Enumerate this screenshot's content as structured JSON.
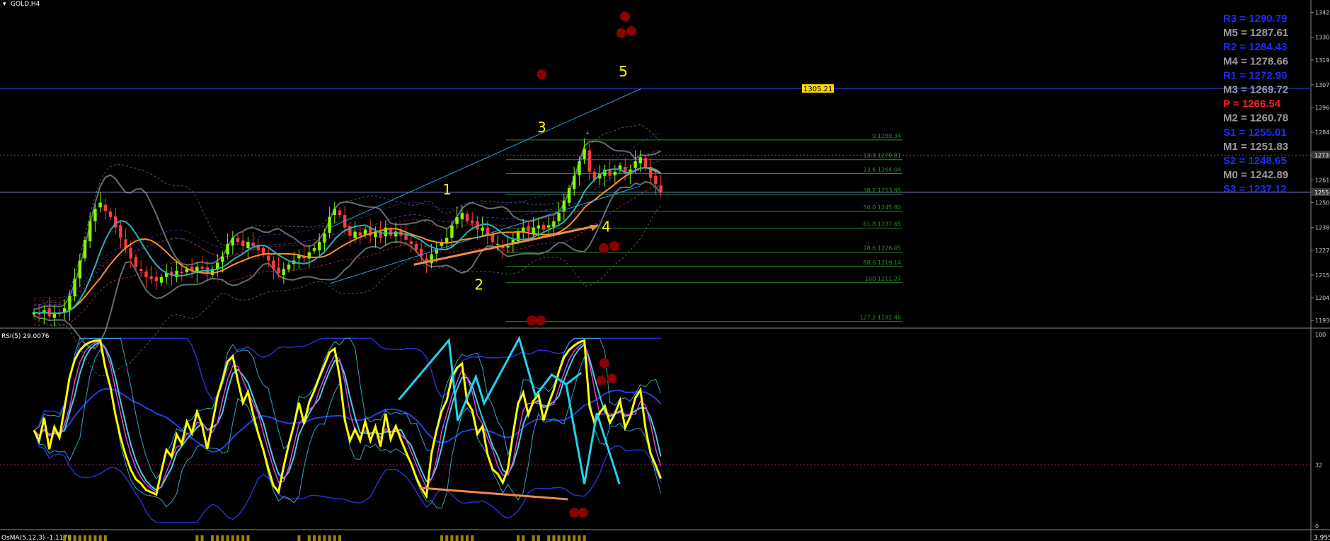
{
  "window": {
    "symbol_label": "GOLD,H4",
    "rsi_label": "RSI(5) 29.0076",
    "osma_label": "OsMA(5,12,3) -1.1178",
    "osma_axis_label": "3.955"
  },
  "colors": {
    "background": "#000000",
    "bull_candle": "#7CFC00",
    "bear_candle": "#ff3b3b",
    "horizontal_line": "#2f3fd8",
    "hline_label_bg": "#ffd700",
    "wave_label": "#ffff00",
    "fib": "#2e8b2e",
    "rsi_main": "#ffff00",
    "arrow_cyan": "#22d3ee",
    "arrow_orange": "#f08a4b",
    "dot": "#8b0000"
  },
  "price_axis": {
    "ticks": [
      "1342",
      "1330",
      "1319",
      "1307",
      "1296",
      "1284",
      "1273",
      "1261",
      "1250",
      "1238",
      "1227",
      "1215",
      "1204",
      "1193"
    ],
    "marker_1": "1273",
    "marker_2": "1255"
  },
  "rsi_axis": {
    "ticks": [
      "100",
      "32",
      "0"
    ]
  },
  "horizontal_line_label": "1305.21",
  "pivots": [
    {
      "label": "R3 = 1290.79",
      "color": "#1f2bff"
    },
    {
      "label": "M5 = 1287.61",
      "color": "#9a9a9a"
    },
    {
      "label": "R2 = 1284.43",
      "color": "#1f2bff"
    },
    {
      "label": "M4 = 1278.66",
      "color": "#9a9a9a"
    },
    {
      "label": "R1 = 1272.90",
      "color": "#1f2bff"
    },
    {
      "label": "M3 = 1269.72",
      "color": "#9a9a9a"
    },
    {
      "label": "P   = 1266.54",
      "color": "#ff2020"
    },
    {
      "label": "M2 = 1260.78",
      "color": "#9a9a9a"
    },
    {
      "label": "S1 = 1255.01",
      "color": "#1f2bff"
    },
    {
      "label": "M1 = 1251.83",
      "color": "#9a9a9a"
    },
    {
      "label": "S2 = 1248.65",
      "color": "#1f2bff"
    },
    {
      "label": "M0 = 1242.89",
      "color": "#9a9a9a"
    },
    {
      "label": "S3 = 1237.12",
      "color": "#1f2bff"
    }
  ],
  "fib_levels": [
    "0 1280.34",
    "13.8 1270.81",
    "23.6 1264.04",
    "38.2 1253.95",
    "50.0 1245.80",
    "61.8 1237.65",
    "78.6 1226.05",
    "88.6 1219.14",
    "100 1211.27",
    "127.2 1192.48"
  ],
  "wave_labels": [
    "1",
    "2",
    "3",
    "4",
    "5"
  ],
  "chart_data": {
    "type": "candlestick",
    "symbol": "GOLD",
    "timeframe": "H4",
    "y_range": [
      1190,
      1348
    ],
    "closes": [
      1197,
      1196,
      1198,
      1195,
      1197,
      1196,
      1199,
      1205,
      1213,
      1222,
      1232,
      1241,
      1247,
      1250,
      1246,
      1243,
      1238,
      1233,
      1228,
      1223,
      1219,
      1217,
      1214,
      1213,
      1212,
      1214,
      1216,
      1215,
      1217,
      1216,
      1218,
      1217,
      1219,
      1218,
      1216,
      1218,
      1221,
      1224,
      1230,
      1233,
      1231,
      1229,
      1231,
      1229,
      1227,
      1225,
      1222,
      1218,
      1216,
      1218,
      1220,
      1222,
      1225,
      1223,
      1226,
      1228,
      1231,
      1235,
      1243,
      1247,
      1244,
      1238,
      1234,
      1236,
      1234,
      1237,
      1234,
      1236,
      1233,
      1238,
      1234,
      1236,
      1234,
      1232,
      1230,
      1227,
      1224,
      1221,
      1225,
      1228,
      1231,
      1233,
      1239,
      1243,
      1245,
      1241,
      1240,
      1237,
      1238,
      1234,
      1231,
      1230,
      1228,
      1229,
      1232,
      1236,
      1238,
      1236,
      1238,
      1239,
      1237,
      1239,
      1241,
      1245,
      1251,
      1257,
      1263,
      1270,
      1276,
      1265,
      1261,
      1264,
      1266,
      1263,
      1265,
      1268,
      1264,
      1266,
      1270,
      1272,
      1267,
      1262,
      1259,
      1255
    ],
    "wave_labels": [
      "1",
      "2",
      "3",
      "4",
      "5"
    ],
    "fib_levels": [
      {
        "level": 0,
        "price": 1280.34
      },
      {
        "level": 13.8,
        "price": 1270.81
      },
      {
        "level": 23.6,
        "price": 1264.04
      },
      {
        "level": 38.2,
        "price": 1253.95
      },
      {
        "level": 50.0,
        "price": 1245.8
      },
      {
        "level": 61.8,
        "price": 1237.65
      },
      {
        "level": 78.6,
        "price": 1226.05
      },
      {
        "level": 88.6,
        "price": 1219.14
      },
      {
        "level": 100,
        "price": 1211.27
      },
      {
        "level": 127.2,
        "price": 1192.48
      }
    ],
    "horizontal_line_price": 1305.21,
    "pivots": {
      "R3": 1290.79,
      "M5": 1287.61,
      "R2": 1284.43,
      "M4": 1278.66,
      "R1": 1272.9,
      "M3": 1269.72,
      "P": 1266.54,
      "M2": 1260.78,
      "S1": 1255.01,
      "M1": 1251.83,
      "S2": 1248.65,
      "M0": 1242.89,
      "S3": 1237.12
    },
    "rsi": {
      "period": 5,
      "last_value": 29.0076,
      "y_range": [
        0,
        100
      ],
      "level_line": 32
    },
    "osma": {
      "params": "5,12,3",
      "last_value": -1.1178
    }
  }
}
